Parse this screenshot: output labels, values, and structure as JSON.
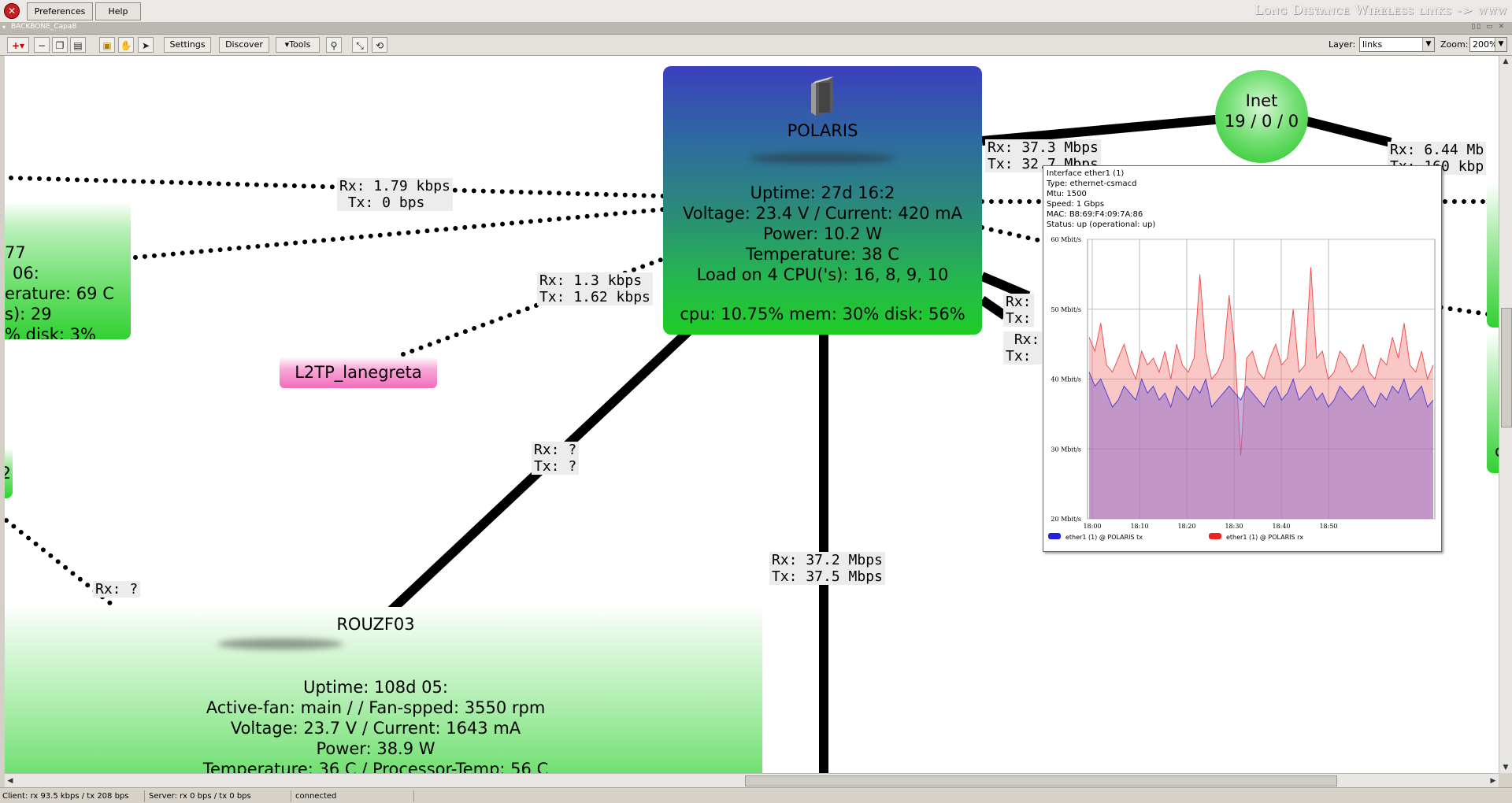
{
  "menu": {
    "preferences": "Preferences",
    "help": "Help"
  },
  "brand": "Long Distance Wireless links -> www",
  "tab": {
    "name": "BACKBONE_Capa8"
  },
  "toolbar": {
    "settings": "Settings",
    "discover": "Discover",
    "tools": "Tools",
    "layer_label": "Layer:",
    "layer_value": "links",
    "zoom_label": "Zoom:",
    "zoom_value": "200%"
  },
  "nodes": {
    "polaris": {
      "name": "POLARIS",
      "uptime": "Uptime: 27d 16:2",
      "voltage": "Voltage: 23.4 V / Current: 420 mA",
      "power": "Power: 10.2 W",
      "temperature": "Temperature: 38 C",
      "load": "Load on 4 CPU('s): 16, 8, 9, 10",
      "usage": "cpu: 10.75% mem: 30% disk: 56%"
    },
    "inet": {
      "name": "Inet",
      "counts": "19 / 0 / 0"
    },
    "left_partial": {
      "line1": "77",
      "line2": "06:",
      "line3": "erature: 69 C",
      "line4": "s): 29",
      "line5": "% disk: 3%"
    },
    "left_partial2": {
      "text": "2"
    },
    "right_partial2": {
      "text": "c"
    },
    "l2tp": {
      "name": "L2TP_lanegreta"
    },
    "rouzf03": {
      "name": "ROUZF03",
      "uptime": "Uptime: 108d 05:",
      "fan": "Active-fan: main /  / Fan-spped: 3550 rpm",
      "voltage": "Voltage: 23.7 V / Current: 1643 mA",
      "power": "Power: 38.9 W",
      "temperature": "Temperature: 36 C / Processor-Temp: 56 C"
    }
  },
  "link_labels": {
    "l1": "Rx: 1.79 kbps\n Tx: 0 bps",
    "l2": "Rx: 1.3 kbps\nTx: 1.62 kbps",
    "l3": "Rx: ?\nTx: ?",
    "l4": "Rx: ?\nTx: ?",
    "l5": "Rx: 37.2 Mbps\nTx: 37.5 Mbps",
    "l6": "Rx: 37.3 Mbps\nTx: 32.7 Mbps",
    "l7": "Rx: 6.44 Mb\nTx: 160 kbp",
    "l8": "Rx:\nTx:",
    "l9": " Rx:\nTx:"
  },
  "tooltip": {
    "interface": "Interface ether1 (1)",
    "type": "Type: ethernet-csmacd",
    "mtu": "Mtu: 1500",
    "speed": "Speed: 1 Gbps",
    "mac": "MAC: B8:69:F4:09:7A:86",
    "status": "Status: up (operational: up)"
  },
  "chart_data": {
    "type": "area",
    "title": "",
    "xlabel": "",
    "ylabel": "",
    "x_ticks": [
      "18:00",
      "18:10",
      "18:20",
      "18:30",
      "18:40",
      "18:50"
    ],
    "y_ticks": [
      "20 Mbit/s",
      "30 Mbit/s",
      "40 Mbit/s",
      "50 Mbit/s",
      "60 Mbit/s"
    ],
    "ylim": [
      20,
      60
    ],
    "grid": true,
    "legend_placement": "bottom",
    "series": [
      {
        "name": "ether1 (1) @ POLARIS tx",
        "color": "#2222dd",
        "values": [
          41,
          39,
          40,
          38,
          36,
          37,
          39,
          38,
          37,
          40,
          38,
          39,
          37,
          38,
          36,
          39,
          38,
          37,
          39,
          38,
          40,
          36,
          37,
          38,
          39,
          38,
          37,
          39,
          38,
          37,
          36,
          38,
          39,
          37,
          38,
          40,
          37,
          38,
          39,
          37,
          38,
          36,
          37,
          39,
          38,
          37,
          38,
          39,
          37,
          36,
          38,
          37,
          39,
          38,
          40,
          37,
          38,
          39,
          36,
          37
        ]
      },
      {
        "name": "ether1 (1) @ POLARIS rx",
        "color": "#ee2222",
        "values": [
          46,
          44,
          48,
          42,
          41,
          43,
          45,
          42,
          40,
          44,
          42,
          43,
          41,
          44,
          40,
          45,
          42,
          41,
          43,
          55,
          44,
          40,
          41,
          43,
          52,
          44,
          29,
          43,
          44,
          41,
          40,
          43,
          45,
          42,
          43,
          50,
          41,
          42,
          56,
          43,
          44,
          40,
          41,
          44,
          43,
          41,
          42,
          45,
          41,
          40,
          43,
          42,
          46,
          43,
          48,
          42,
          41,
          44,
          40,
          42
        ]
      }
    ]
  },
  "status": {
    "client": "Client: rx 93.5 kbps / tx 208 bps",
    "server": "Server: rx 0 bps / tx 0 bps",
    "state": "connected"
  }
}
